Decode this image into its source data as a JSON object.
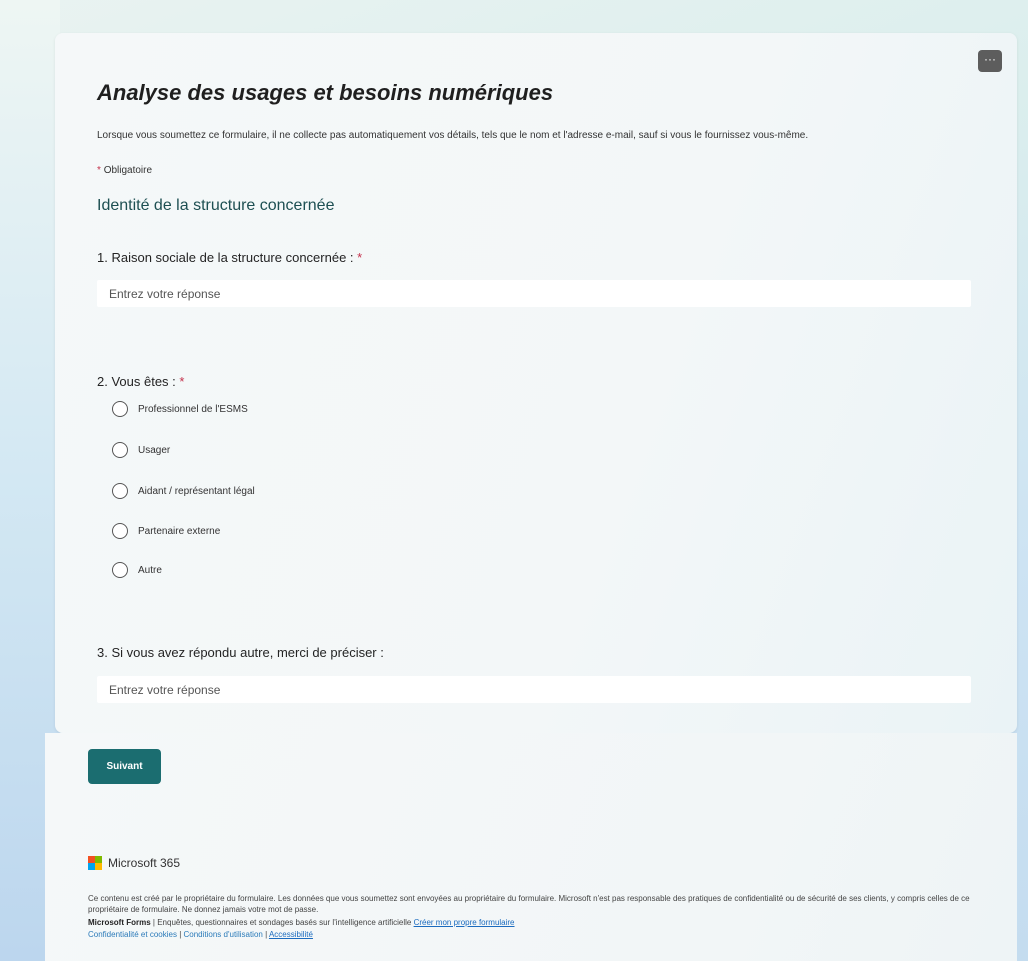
{
  "form": {
    "title": "Analyse des usages et besoins numériques",
    "description": "Lorsque vous soumettez ce formulaire, il ne collecte pas automatiquement vos détails, tels que le nom et l'adresse e-mail, sauf si vous le fournissez vous-même.",
    "required_marker": "*",
    "required_label": "Obligatoire",
    "more_options_label": "···"
  },
  "section": {
    "title": "Identité de la structure concernée"
  },
  "questions": [
    {
      "label": "1. Raison sociale de la structure concernée :",
      "required": true,
      "placeholder": "Entrez votre réponse"
    },
    {
      "label": "2. Vous êtes :",
      "required": true,
      "options": [
        "Professionnel de l'ESMS",
        "Usager",
        "Aidant / représentant légal",
        "Partenaire externe",
        "Autre"
      ]
    },
    {
      "label": "3. Si vous avez répondu autre, merci de préciser :",
      "required": false,
      "placeholder": "Entrez votre réponse"
    }
  ],
  "buttons": {
    "next_label": "Suivant"
  },
  "footer": {
    "brand": "Microsoft 365",
    "disclaimer": "Ce contenu est créé par le propriétaire du formulaire. Les données que vous soumettez sont envoyées au propriétaire du formulaire. Microsoft n'est pas responsable des pratiques de confidentialité ou de sécurité de ses clients, y compris celles de ce propriétaire de formulaire. Ne donnez jamais votre mot de passe.",
    "product_name": "Microsoft Forms",
    "product_tagline": "| Enquêtes, questionnaires et sondages basés sur l'intelligence artificielle",
    "create_link": "Créer mon propre formulaire",
    "privacy_link": "Confidentialité et cookies",
    "separator": "|",
    "terms_link": "Conditions d'utilisation",
    "accessibility_link": "Accessibilité"
  },
  "colors": {
    "accent": "#1b6d70",
    "required": "#c4314b",
    "section_title": "#1d4f52"
  }
}
